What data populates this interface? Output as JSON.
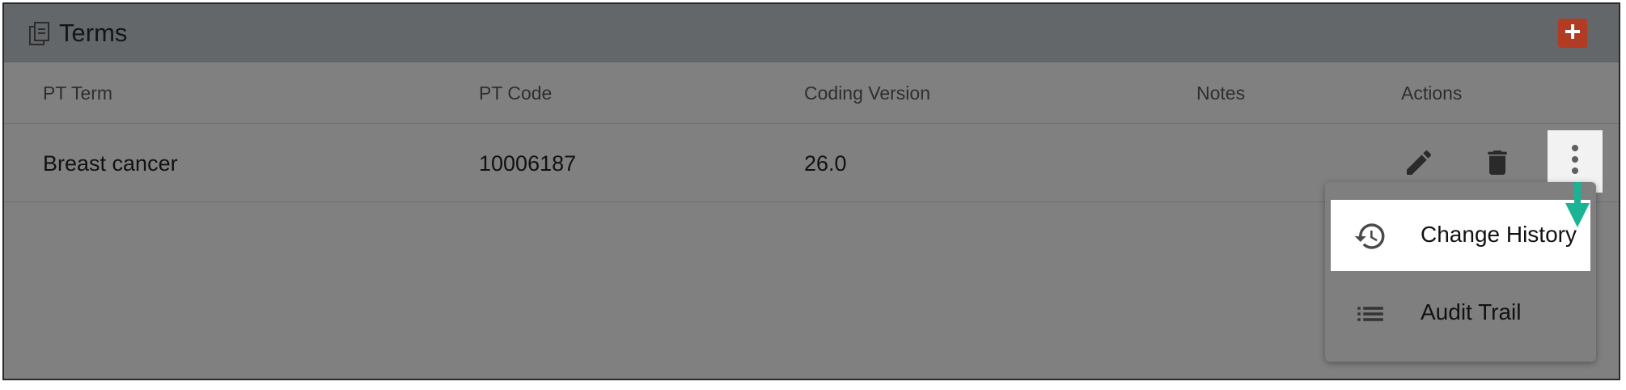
{
  "panel": {
    "title": "Terms",
    "title_icon": "clipboard-copy-icon",
    "add_icon": "plus-icon"
  },
  "table": {
    "columns": [
      "PT Term",
      "PT Code",
      "Coding Version",
      "Notes",
      "Actions"
    ],
    "rows": [
      {
        "pt_term": "Breast cancer",
        "pt_code": "10006187",
        "coding_version": "26.0",
        "notes": ""
      }
    ],
    "row_actions": [
      "pencil-edit-icon",
      "trash-delete-icon",
      "more-vertical-icon"
    ]
  },
  "menu": {
    "items": [
      {
        "label": "Change History",
        "icon": "history-icon",
        "highlighted": true
      },
      {
        "label": "Audit Trail",
        "icon": "list-icon",
        "highlighted": false
      }
    ]
  },
  "colors": {
    "overlay": "#808080",
    "header": "#63676a",
    "add_button": "#b23b24",
    "arrow": "#1ab394"
  }
}
